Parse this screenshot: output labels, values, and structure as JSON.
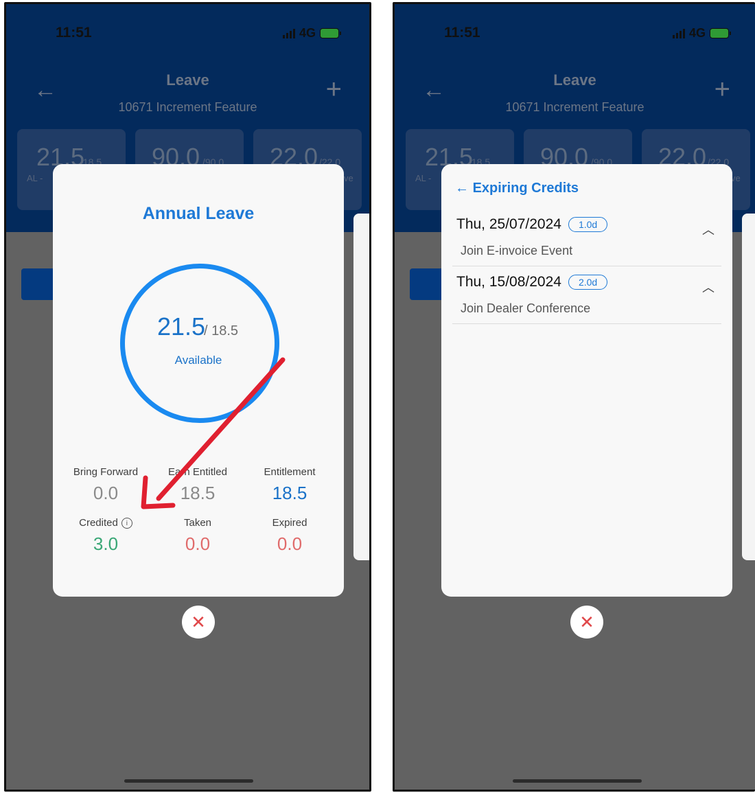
{
  "status": {
    "time": "11:51",
    "network": "4G"
  },
  "header": {
    "title": "Leave",
    "subtitle": "10671 Increment Feature"
  },
  "summary_cards": [
    {
      "value": "21.5",
      "total": "/18.5",
      "label": "AL - "
    },
    {
      "value": "90.0",
      "total": "/90.0",
      "label": ""
    },
    {
      "value": "22.0",
      "total": "/22.0",
      "label": "ve"
    }
  ],
  "annual_leave": {
    "title": "Annual Leave",
    "available": "21.5",
    "total": "/ 18.5",
    "available_label": "Available",
    "stats": {
      "bring_forward": {
        "label": "Bring Forward",
        "value": "0.0"
      },
      "earn_entitled": {
        "label": "Earn Entitled",
        "value": "18.5"
      },
      "entitlement": {
        "label": "Entitlement",
        "value": "18.5"
      },
      "credited": {
        "label": "Credited",
        "value": "3.0"
      },
      "taken": {
        "label": "Taken",
        "value": "0.0"
      },
      "expired": {
        "label": "Expired",
        "value": "0.0"
      }
    }
  },
  "expiring_credits": {
    "title": "Expiring Credits",
    "items": [
      {
        "date": "Thu, 25/07/2024",
        "badge": "1.0d",
        "description": "Join E-invoice Event"
      },
      {
        "date": "Thu, 15/08/2024",
        "badge": "2.0d",
        "description": "Join Dealer Conference"
      }
    ]
  },
  "icons": {
    "back": "arrow-left-icon",
    "add": "plus-icon",
    "close": "close-icon",
    "info": "info-icon",
    "expand": "chevron-up-icon"
  },
  "colors": {
    "primary": "#1e79d6",
    "appbar": "#032a5c",
    "credited": "#3aa776",
    "negative": "#e06b6b",
    "annotation_arrow": "#e02030"
  }
}
